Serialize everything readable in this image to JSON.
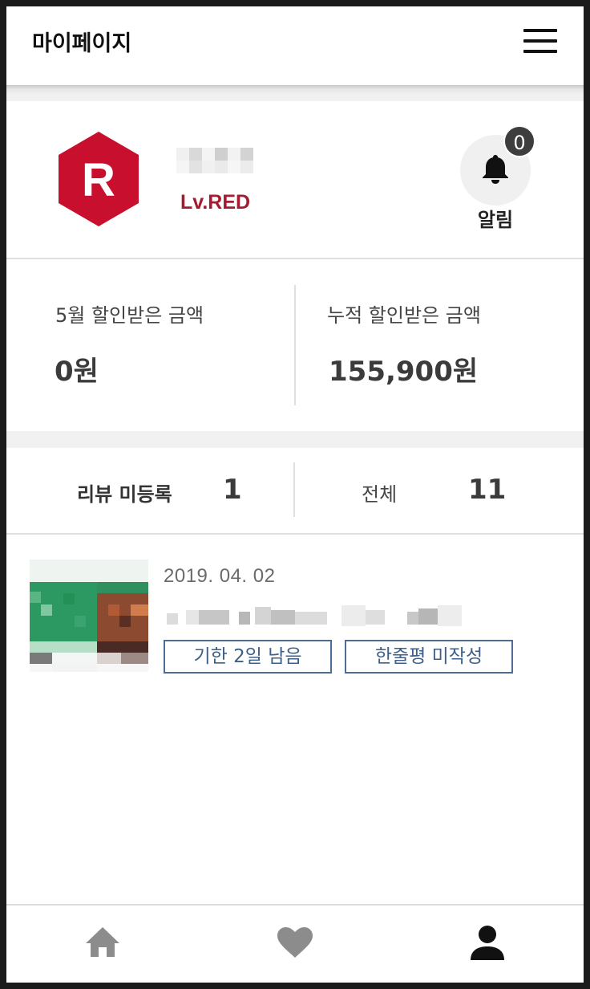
{
  "header": {
    "title": "마이페이지",
    "menu_icon": "hamburger-menu-icon"
  },
  "profile": {
    "badge_letter": "R",
    "badge_color": "#c8102e",
    "level": "Lv.RED",
    "level_color": "#a51c30",
    "notification": {
      "icon": "bell-icon",
      "count": "0",
      "label": "알림"
    }
  },
  "savings": {
    "monthly": {
      "label": "5월 할인받은 금액",
      "value": "0원"
    },
    "total": {
      "label": "누적 할인받은 금액",
      "value": "155,900원"
    }
  },
  "review_tabs": [
    {
      "label": "리뷰 미등록",
      "count": "1",
      "active": true
    },
    {
      "label": "전체",
      "count": "11",
      "active": false
    }
  ],
  "review_items": [
    {
      "date": "2019. 04. 02",
      "tags": [
        "기한 2일 남음",
        "한줄평 미작성"
      ],
      "tag_color": "#4d6d96"
    }
  ],
  "bottom_nav": [
    {
      "icon": "home-icon",
      "active": false
    },
    {
      "icon": "heart-icon",
      "active": false
    },
    {
      "icon": "person-icon",
      "active": true
    }
  ]
}
